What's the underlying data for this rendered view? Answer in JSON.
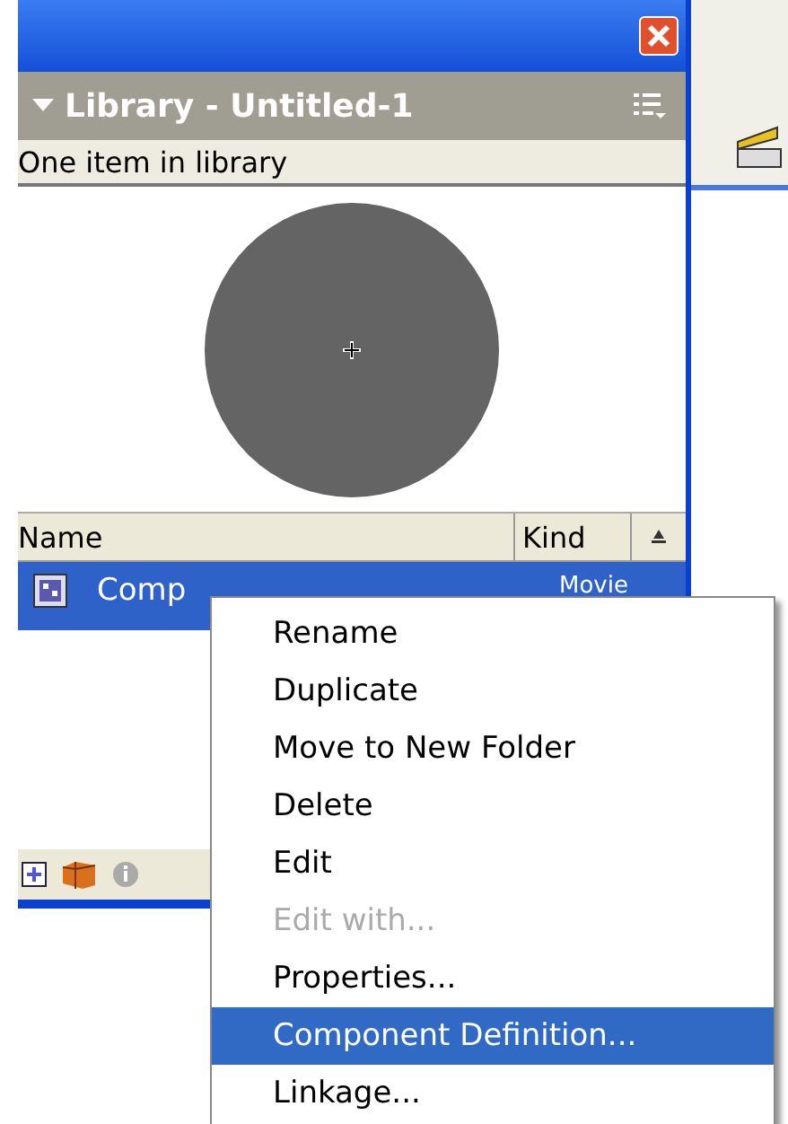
{
  "panel": {
    "title": "Library - Untitled-1",
    "summary": "One item in library"
  },
  "columns": [
    {
      "label": "Name"
    },
    {
      "label": "Kind"
    }
  ],
  "items": [
    {
      "name": "Comp",
      "kind": "Movie",
      "selected": true
    }
  ],
  "context_menu": [
    {
      "label": "Rename",
      "disabled": false,
      "selected": false
    },
    {
      "label": "Duplicate",
      "disabled": false,
      "selected": false
    },
    {
      "label": "Move to New Folder",
      "disabled": false,
      "selected": false
    },
    {
      "label": "Delete",
      "disabled": false,
      "selected": false
    },
    {
      "label": "Edit",
      "disabled": false,
      "selected": false
    },
    {
      "label": "Edit with...",
      "disabled": true,
      "selected": false
    },
    {
      "label": "Properties...",
      "disabled": false,
      "selected": false
    },
    {
      "label": "Component Definition...",
      "disabled": false,
      "selected": true
    },
    {
      "label": "Linkage...",
      "disabled": false,
      "selected": false
    }
  ]
}
